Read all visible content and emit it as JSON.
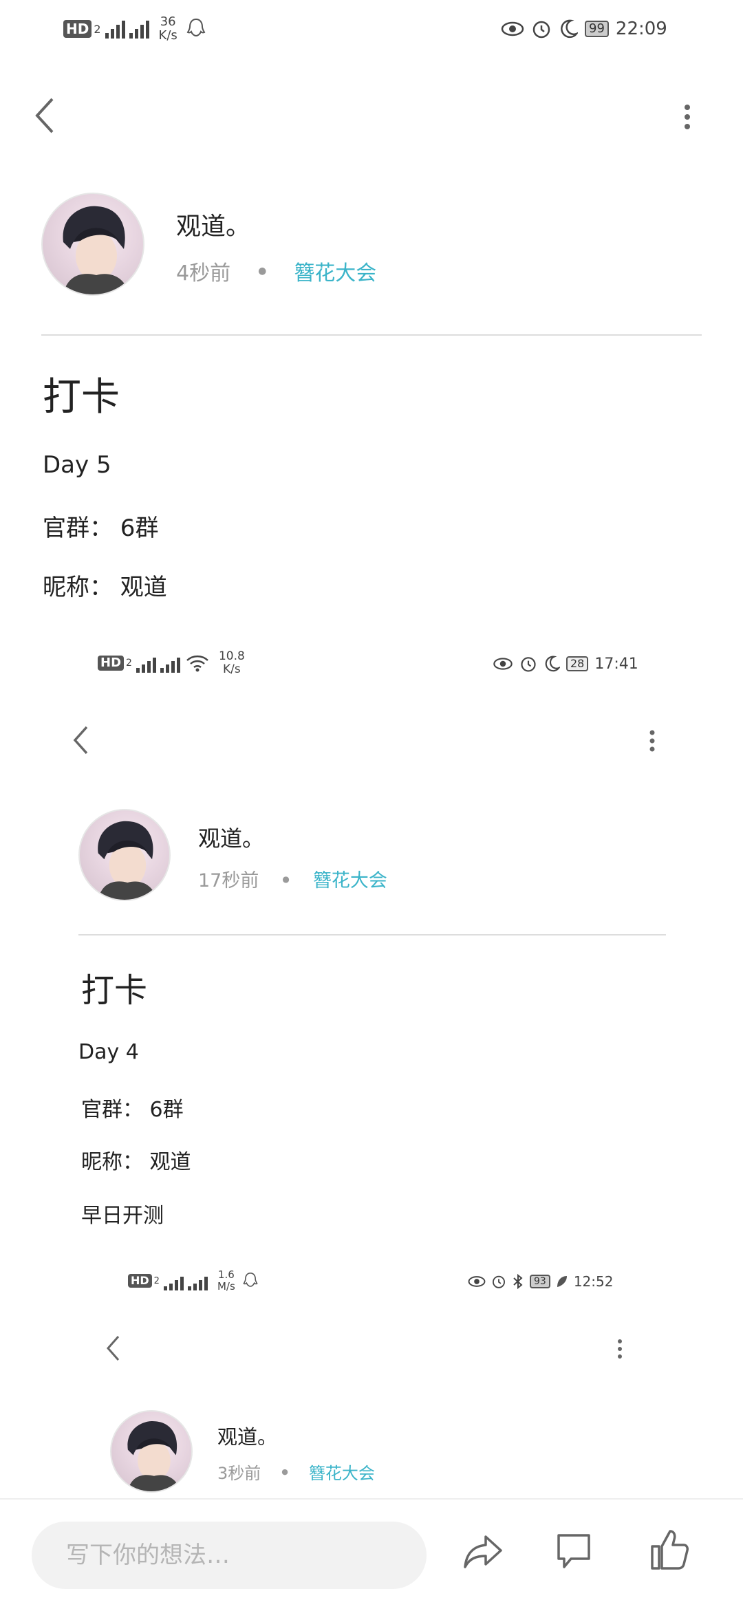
{
  "status_bar_1": {
    "hd": "HD",
    "sim": "2",
    "net_top": "36",
    "net_bottom": "K/s",
    "battery": "99",
    "time": "22:09"
  },
  "post_1": {
    "author": "观道。",
    "time": "4秒前",
    "community": "簪花大会",
    "title": "打卡",
    "lines": [
      "Day 5",
      "官群： 6群",
      "昵称： 观道"
    ]
  },
  "status_bar_2": {
    "hd": "HD",
    "sim": "2",
    "net_top": "10.8",
    "net_bottom": "K/s",
    "battery": "28",
    "time": "17:41"
  },
  "post_2": {
    "author": "观道。",
    "time": "17秒前",
    "community": "簪花大会",
    "title": "打卡",
    "lines": [
      "Day 4",
      "官群： 6群",
      "昵称： 观道",
      "早日开测"
    ]
  },
  "status_bar_3": {
    "hd": "HD",
    "sim": "2",
    "net_top": "1.6",
    "net_bottom": "M/s",
    "battery": "93",
    "time": "12:52"
  },
  "post_3": {
    "author": "观道。",
    "time": "3秒前",
    "community": "簪花大会"
  },
  "comment": {
    "placeholder": "写下你的想法…"
  }
}
